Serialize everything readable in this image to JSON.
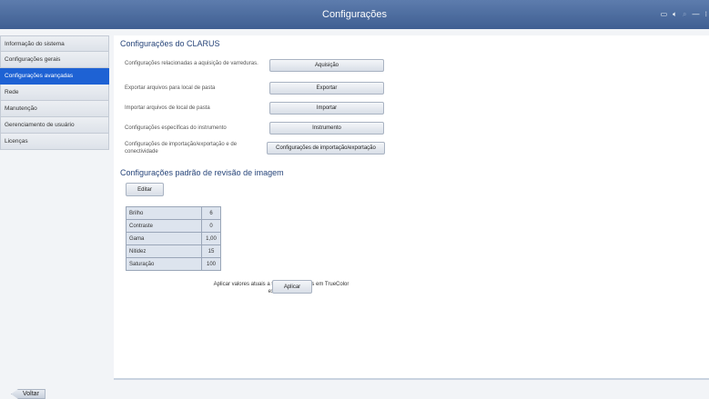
{
  "window": {
    "title": "Configurações"
  },
  "sidebar": {
    "items": [
      {
        "label": "Informação do sistema"
      },
      {
        "label": "Configurações gerais"
      },
      {
        "label": "Configurações avançadas"
      },
      {
        "label": "Rede"
      },
      {
        "label": "Manutenção"
      },
      {
        "label": "Gerenciamento de usuário"
      },
      {
        "label": "Licenças"
      }
    ],
    "active": "Configurações avançadas"
  },
  "clarus": {
    "heading": "Configurações do CLARUS",
    "rows": [
      {
        "label": "Configurações relacionadas a aquisição de varreduras.",
        "button": "Aquisição"
      },
      {
        "label": "Exportar arquivos para local de pasta",
        "button": "Exportar"
      },
      {
        "label": "Importar arquivos de local de pasta",
        "button": "Importar"
      },
      {
        "label": "Configurações específicas do instrumento",
        "button": "Instrumento"
      },
      {
        "label": "Configurações de importação/exportação e de conectividade",
        "button": "Configurações de importação/exportação"
      }
    ]
  },
  "review": {
    "heading": "Configurações padrão de revisão de imagem",
    "edit_label": "Editar",
    "values": [
      {
        "name": "Brilho",
        "value": "6"
      },
      {
        "name": "Contraste",
        "value": "0"
      },
      {
        "name": "Gama",
        "value": "1,00"
      },
      {
        "name": "Nitidez",
        "value": "15"
      },
      {
        "name": "Saturação",
        "value": "100"
      }
    ],
    "apply_text": "Aplicar valores atuais a todas as imagens em TrueColor existentes.",
    "apply_label": "Aplicar"
  },
  "footer": {
    "back_label": "Voltar"
  }
}
